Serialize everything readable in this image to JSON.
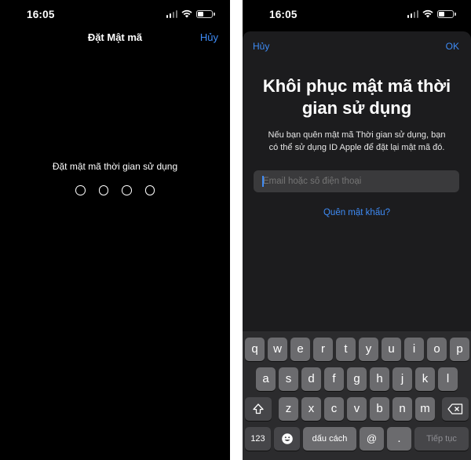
{
  "left_screen": {
    "status_bar": {
      "time": "16:05"
    },
    "nav": {
      "title": "Đặt Mật mã",
      "cancel": "Hủy"
    },
    "prompt": "Đặt mật mã thời gian sử dụng",
    "passcode_length": 4
  },
  "right_screen": {
    "status_bar": {
      "time": "16:05"
    },
    "nav": {
      "cancel": "Hủy",
      "ok": "OK"
    },
    "title_line1": "Khôi phục mật mã thời",
    "title_line2": "gian sử dụng",
    "description_line1": "Nếu bạn quên mật mã Thời gian sử dụng, bạn",
    "description_line2": "có thể sử dụng ID Apple để đặt lại mật mã đó.",
    "input": {
      "value": "",
      "placeholder": "Email hoặc số điện thoại"
    },
    "forgot_link": "Quên mật khẩu?",
    "keyboard": {
      "row1": [
        "q",
        "w",
        "e",
        "r",
        "t",
        "y",
        "u",
        "i",
        "o",
        "p"
      ],
      "row2": [
        "a",
        "s",
        "d",
        "f",
        "g",
        "h",
        "j",
        "k",
        "l"
      ],
      "row3": [
        "z",
        "x",
        "c",
        "v",
        "b",
        "n",
        "m"
      ],
      "numbers_key": "123",
      "emoji_icon": "emoji-icon",
      "space_key": "dấu cách",
      "at_key": "@",
      "dot_key": ".",
      "next_key": "Tiếp tục",
      "shift_icon": "shift-icon",
      "delete_icon": "delete-icon"
    }
  }
}
